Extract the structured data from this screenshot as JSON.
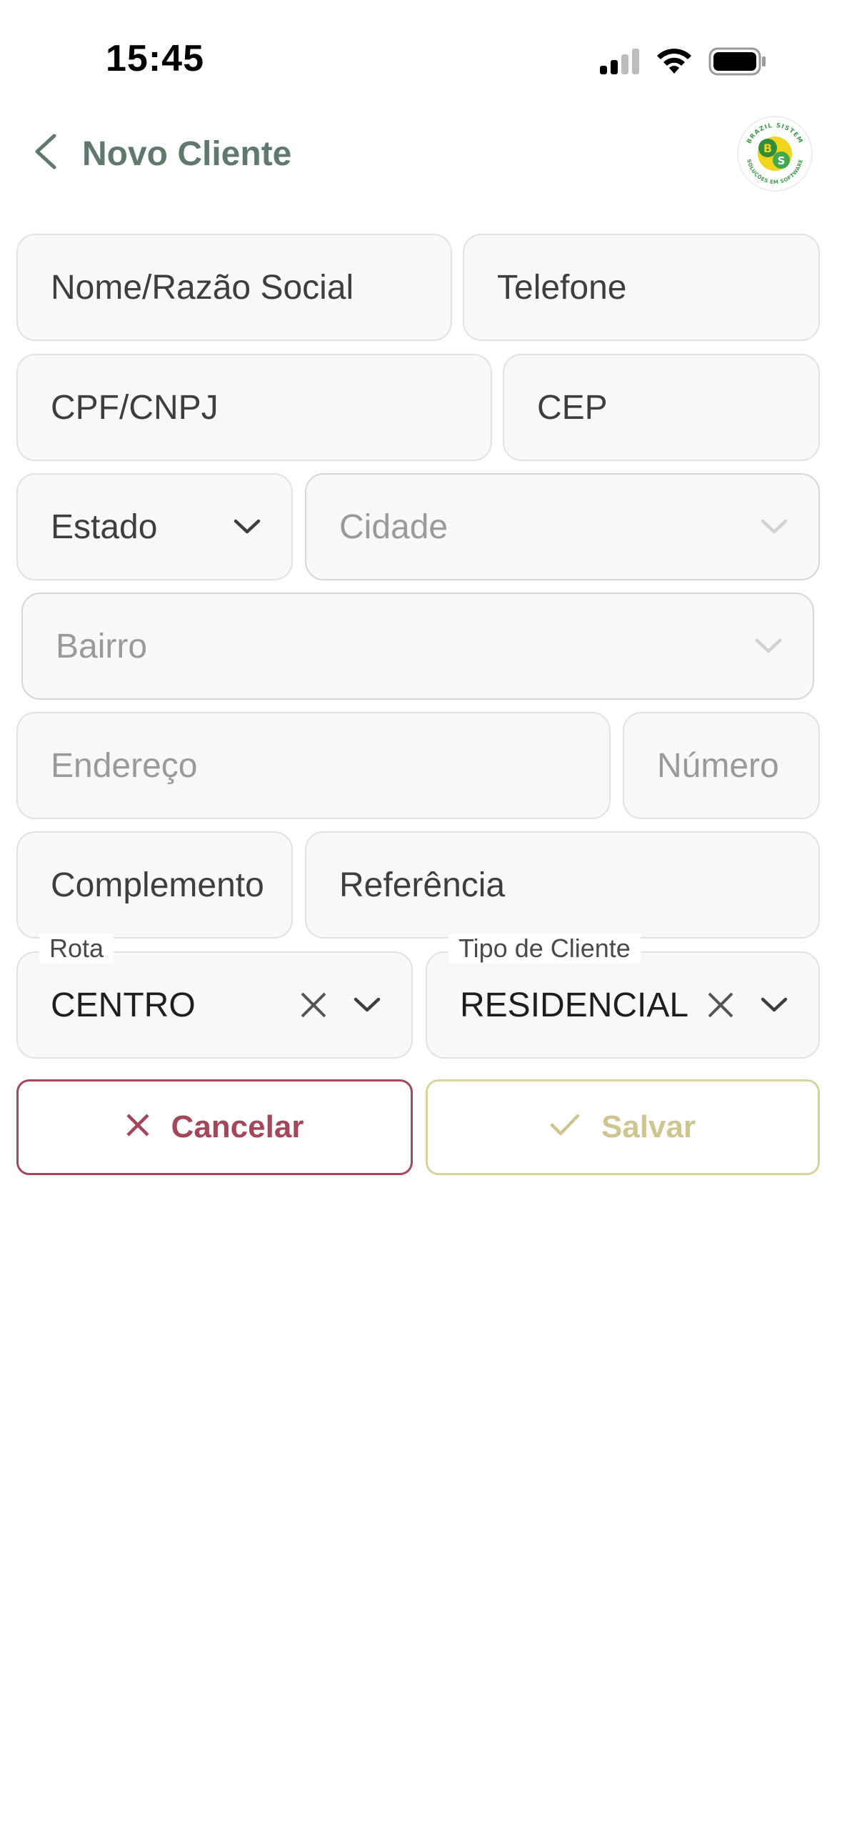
{
  "status_bar": {
    "time": "15:45"
  },
  "header": {
    "title": "Novo Cliente",
    "back_icon": "chevron-left-icon",
    "logo_text_top": "BRAZIL SISTEM",
    "logo_text_bottom": "SOLUÇÕES EM SOFTWARE",
    "logo_initials_b": "B",
    "logo_initials_s": "S"
  },
  "form": {
    "nome_placeholder": "Nome/Razão Social",
    "telefone_placeholder": "Telefone",
    "cpf_placeholder": "CPF/CNPJ",
    "cep_placeholder": "CEP",
    "estado_placeholder": "Estado",
    "cidade_placeholder": "Cidade",
    "bairro_placeholder": "Bairro",
    "endereco_placeholder": "Endereço",
    "numero_placeholder": "Número",
    "complemento_placeholder": "Complemento",
    "referencia_placeholder": "Referência",
    "rota": {
      "label": "Rota",
      "value": "CENTRO"
    },
    "tipo_cliente": {
      "label": "Tipo de Cliente",
      "value": "RESIDENCIAL"
    }
  },
  "actions": {
    "cancel_label": "Cancelar",
    "save_label": "Salvar"
  },
  "colors": {
    "title": "#5f7a6c",
    "cancel": "#a5475a",
    "save": "#cfc68f",
    "field_bg": "#f8f8f8",
    "field_border": "#e2e2e2"
  }
}
